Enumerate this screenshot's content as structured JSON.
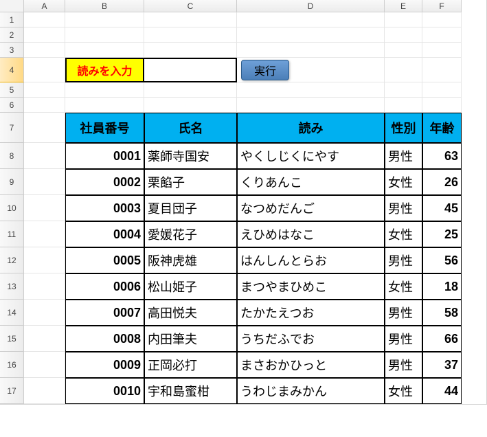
{
  "columns": [
    "A",
    "B",
    "C",
    "D",
    "E",
    "F"
  ],
  "rows": [
    "1",
    "2",
    "3",
    "4",
    "5",
    "6",
    "7",
    "8",
    "9",
    "10",
    "11",
    "12",
    "13",
    "14",
    "15",
    "16",
    "17"
  ],
  "active_row": "4",
  "form": {
    "label": "読みを入力",
    "value": "",
    "button": "実行"
  },
  "headers": [
    "社員番号",
    "氏名",
    "読み",
    "性別",
    "年齢"
  ],
  "chart_data": {
    "type": "table",
    "title": "",
    "columns": [
      "社員番号",
      "氏名",
      "読み",
      "性別",
      "年齢"
    ],
    "rows": [
      [
        "0001",
        "薬師寺国安",
        "やくしじくにやす",
        "男性",
        63
      ],
      [
        "0002",
        "栗餡子",
        "くりあんこ",
        "女性",
        26
      ],
      [
        "0003",
        "夏目団子",
        "なつめだんご",
        "男性",
        45
      ],
      [
        "0004",
        "愛媛花子",
        "えひめはなこ",
        "女性",
        25
      ],
      [
        "0005",
        "阪神虎雄",
        "はんしんとらお",
        "男性",
        56
      ],
      [
        "0006",
        "松山姫子",
        "まつやまひめこ",
        "女性",
        18
      ],
      [
        "0007",
        "高田悦夫",
        "たかたえつお",
        "男性",
        58
      ],
      [
        "0008",
        "内田筆夫",
        "うちだふでお",
        "男性",
        66
      ],
      [
        "0009",
        "正岡必打",
        "まさおかひっと",
        "男性",
        37
      ],
      [
        "0010",
        "宇和島蜜柑",
        "うわじまみかん",
        "女性",
        44
      ]
    ]
  }
}
